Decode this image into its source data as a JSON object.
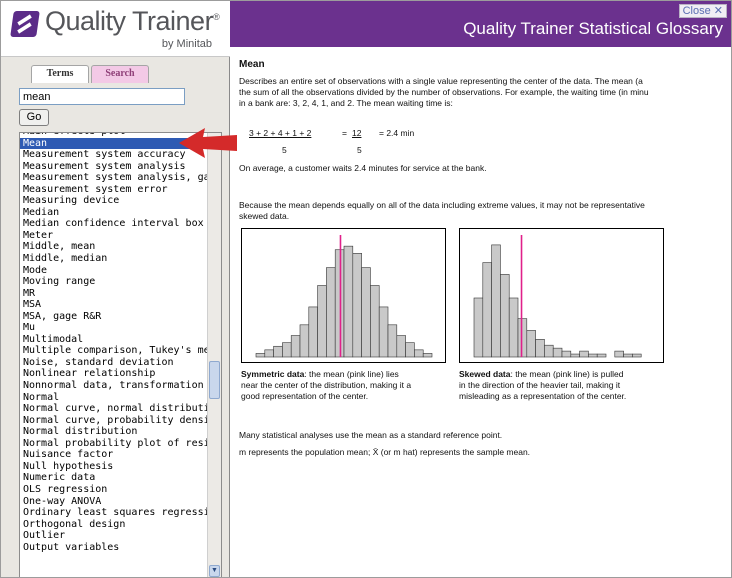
{
  "logo": {
    "title": "Quality Trainer",
    "registered": "®",
    "subtitle": "by Minitab"
  },
  "tabs": {
    "terms": "Terms",
    "search": "Search"
  },
  "search": {
    "value": "mean",
    "go_label": "Go"
  },
  "term_list": {
    "selected": "Mean",
    "items": [
      "Main effects plot",
      "Mean",
      "Measurement system accuracy",
      "Measurement system analysis",
      "Measurement system analysis, ga",
      "Measurement system error",
      "Measuring device",
      "Median",
      "Median confidence interval box",
      "Meter",
      "Middle, mean",
      "Middle, median",
      "Mode",
      "Moving range",
      "MR",
      "MSA",
      "MSA, gage R&R",
      "Mu",
      "Multimodal",
      "Multiple comparison, Tukey's metl",
      "Noise, standard deviation",
      "Nonlinear relationship",
      "Nonnormal data, transformation",
      "Normal",
      "Normal curve, normal distribution",
      "Normal curve, probability density",
      "Normal distribution",
      "Normal probability plot of residual",
      "Nuisance factor",
      "Null hypothesis",
      "Numeric data",
      "OLS regression",
      "One-way ANOVA",
      "Ordinary least squares regression",
      "Orthogonal design",
      "Outlier",
      "Output variables"
    ]
  },
  "header": {
    "title": "Quality Trainer Statistical Glossary",
    "close_label": "Close ✕"
  },
  "article": {
    "heading": "Mean",
    "p1_line1": "Describes an entire set of observations with a single value representing the center of the data. The mean (a",
    "p1_line2": "the sum of all the observations divided by the number of observations. For example, the waiting time (in minu",
    "p1_line3": "in a bank are: 3, 2, 4, 1, and 2. The mean waiting time is:",
    "formula": {
      "numerator": "3 + 2 + 4 + 1 + 2",
      "eq1": "=",
      "sum": "12",
      "eq2": "= 2.4 min",
      "denominator1": "5",
      "denominator2": "5"
    },
    "p2": "On average, a customer waits 2.4 minutes for service at the bank.",
    "p3_line1": "Because the mean depends equally on all of the data including extreme values, it may not be representative",
    "p3_line2": "skewed data.",
    "caption_sym_bold": "Symmetric data",
    "caption_sym_l1": ": the mean (pink line) lies",
    "caption_sym_l2": "near the center of the distribution, making it a",
    "caption_sym_l3": "good representation of the center.",
    "caption_skew_bold": "Skewed data",
    "caption_skew_l1": ": the mean (pink line) is pulled",
    "caption_skew_l2": "in the direction of the heavier tail, making it",
    "caption_skew_l3": "misleading as a representation of the center.",
    "p4": "Many statistical analyses use the mean as a standard reference point.",
    "p5": "m represents the population mean;  X̄ (or m hat) represents the sample mean."
  },
  "colors": {
    "header": "#6b318e",
    "mean_line": "#e0208a",
    "bar_fill": "#c9c9c9",
    "selected_row": "#2e5ab3",
    "arrow": "#d42a2a"
  },
  "chart_data": [
    {
      "type": "bar",
      "name": "symmetric",
      "values": [
        1,
        2,
        3,
        4,
        6,
        9,
        14,
        20,
        25,
        30,
        31,
        29,
        25,
        20,
        14,
        9,
        6,
        4,
        2,
        1
      ],
      "mean_index": 9.6,
      "ymax": 33
    },
    {
      "type": "bar",
      "name": "skewed",
      "values": [
        20,
        32,
        38,
        28,
        20,
        13,
        9,
        6,
        4,
        3,
        2,
        1,
        2,
        1,
        1,
        0,
        2,
        1,
        1,
        0
      ],
      "mean_index": 5.4,
      "ymax": 40
    }
  ]
}
